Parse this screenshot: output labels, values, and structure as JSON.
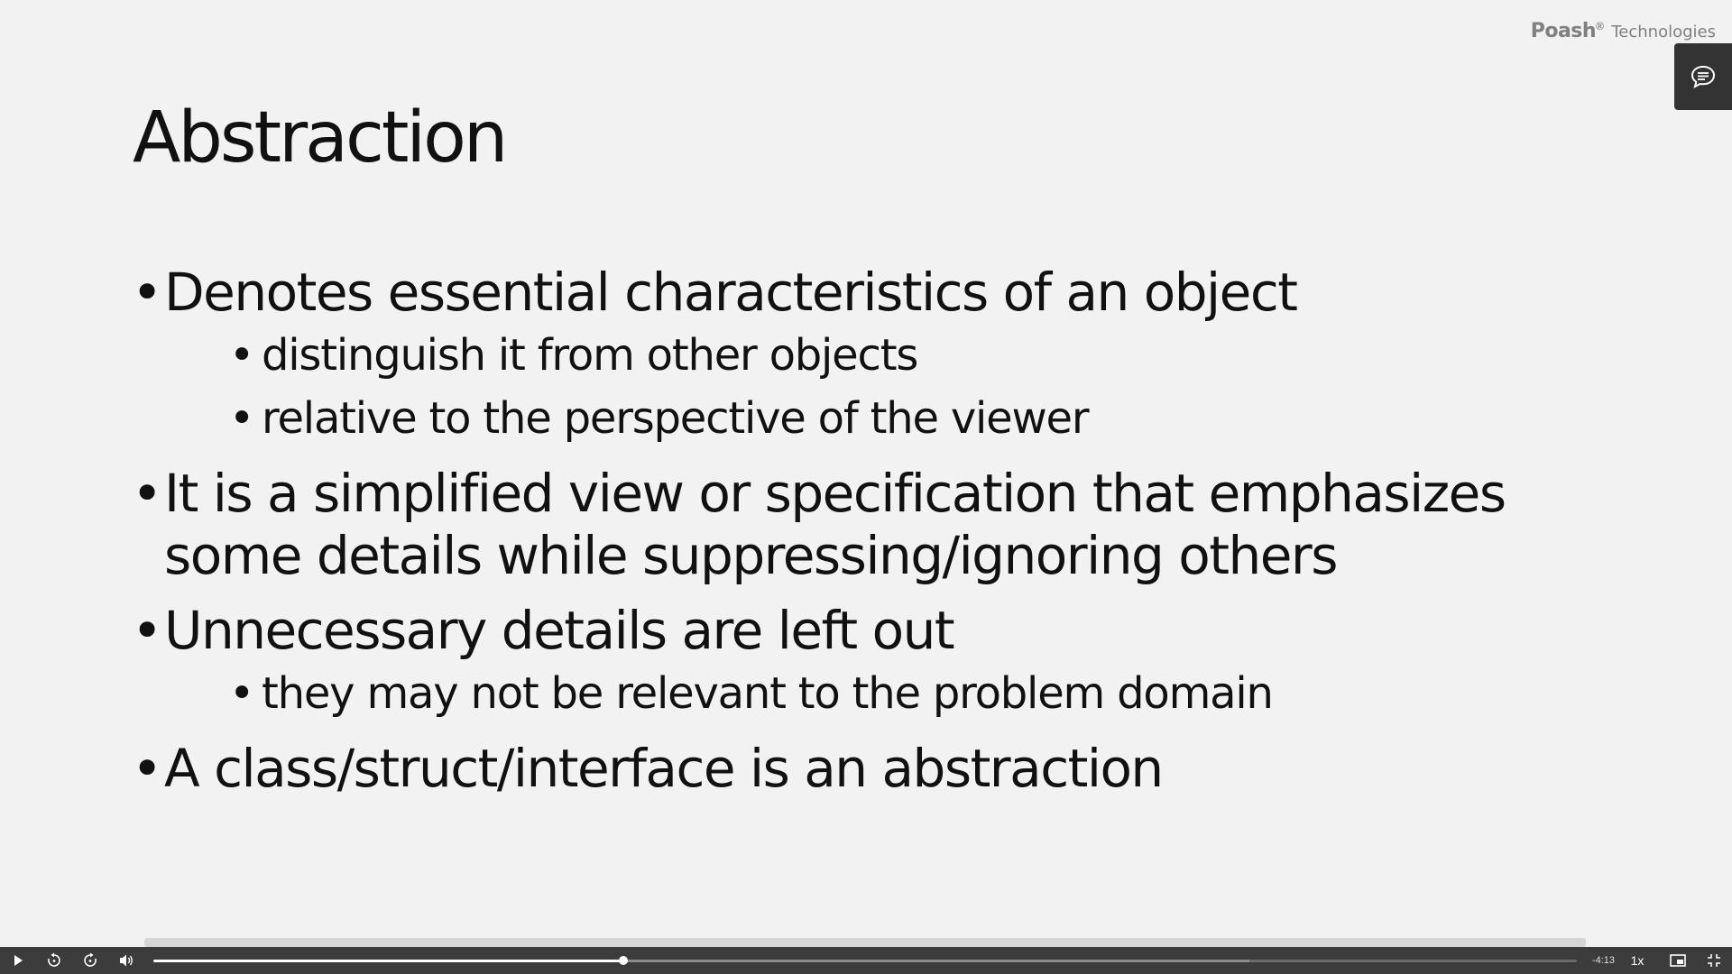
{
  "brand": {
    "name": "Poash",
    "mark": "®",
    "suffix": "Technologies"
  },
  "slide": {
    "title": "Abstraction",
    "bullets": [
      {
        "text": "Denotes essential characteristics of an object",
        "sub": [
          "distinguish it from other objects",
          "relative to the perspective of the viewer"
        ]
      },
      {
        "text": "It is a simplified view or specification that emphasizes some details while suppressing/ignoring others",
        "sub": []
      },
      {
        "text": "Unnecessary details are left out",
        "sub": [
          "they may not be relevant to the problem domain"
        ]
      },
      {
        "text": "A class/struct/interface is an abstraction",
        "sub": []
      }
    ]
  },
  "player": {
    "time_remaining": "-4:13",
    "playback_speed": "1x",
    "progress_fraction": 0.33,
    "buffered_fraction": 0.77,
    "icons": [
      "play-icon",
      "rewind-icon",
      "forward-icon",
      "volume-icon",
      "picture-in-picture-icon",
      "exit-fullscreen-icon",
      "chat-icon"
    ]
  },
  "colors": {
    "slide_bg": "#f2f2f2",
    "player_bg": "#3c3c3c",
    "text": "#111111",
    "brand": "#808080"
  }
}
